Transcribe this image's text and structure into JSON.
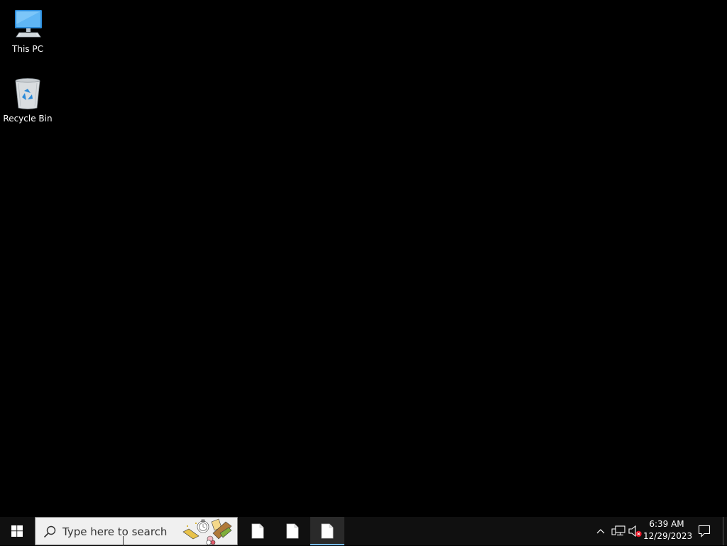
{
  "desktop": {
    "icons": [
      {
        "label": "This PC",
        "icon": "this-pc-icon"
      },
      {
        "label": "Recycle Bin",
        "icon": "recycle-bin-icon"
      }
    ]
  },
  "taskbar": {
    "start_icon": "windows-logo-icon",
    "search": {
      "placeholder": "Type here to search"
    },
    "buttons": [
      {
        "icon": "file-icon",
        "active": false
      },
      {
        "icon": "file-icon",
        "active": false
      },
      {
        "icon": "file-icon",
        "active": true
      }
    ],
    "tray": {
      "icons": [
        "chevron-up-icon",
        "network-icon",
        "volume-muted-icon"
      ],
      "clock": {
        "time": "6:39 AM",
        "date": "12/29/2023"
      },
      "notification_icon": "action-center-icon"
    }
  },
  "colors": {
    "desktop_bg": "#000000",
    "taskbar_bg": "#101010",
    "accent": "#76b9ed",
    "search_bg": "#f0f0f0"
  }
}
